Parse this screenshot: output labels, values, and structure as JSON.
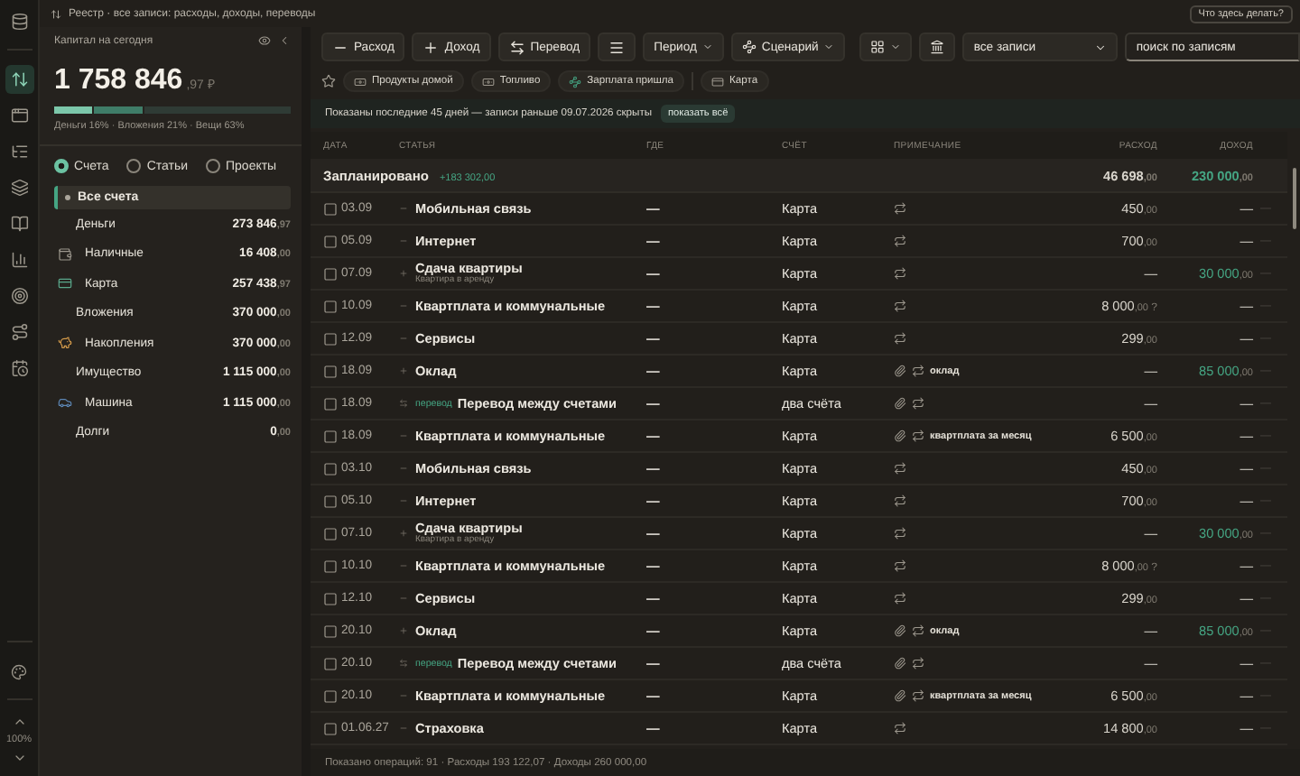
{
  "topbar": {
    "title": "Реестр",
    "subtitle": "· все записи: расходы, доходы, переводы",
    "help_button": "Что здесь делать?"
  },
  "rail": {
    "items": [
      {
        "kind": "registry",
        "selected": true
      },
      {
        "kind": "window",
        "selected": false
      },
      {
        "kind": "list",
        "selected": false
      },
      {
        "kind": "layers",
        "selected": false
      },
      {
        "kind": "book",
        "selected": false
      },
      {
        "kind": "chart",
        "selected": false
      },
      {
        "kind": "target",
        "selected": false
      },
      {
        "kind": "route",
        "selected": false
      },
      {
        "kind": "schedule",
        "selected": false
      }
    ],
    "zoom": "100%"
  },
  "capital": {
    "title": "Капитал на сегодня",
    "amount": "1 758 846",
    "cents": ",97 ₽",
    "segments": [
      {
        "level": 0.16,
        "color": "#7cc7aa"
      },
      {
        "level": 0.21,
        "color": "#3f7d68"
      },
      {
        "level": 0.63,
        "color": "#2f3b35"
      }
    ],
    "legend": "Деньги 16% · Вложения 21% · Вещи 63%"
  },
  "view_modes": [
    {
      "label": "Счета",
      "selected": true
    },
    {
      "label": "Статьи",
      "selected": false
    },
    {
      "label": "Проекты",
      "selected": false
    }
  ],
  "accounts": {
    "all": {
      "label": "Все счета",
      "selected": true
    },
    "groups": [
      {
        "label": "Деньги",
        "amount": "273 846",
        "cents": ",97",
        "children": [
          {
            "kind": "cash",
            "label": "Наличные",
            "amount": "16 408",
            "cents": ",00"
          },
          {
            "kind": "card",
            "label": "Карта",
            "amount": "257 438",
            "cents": ",97"
          }
        ]
      },
      {
        "label": "Вложения",
        "amount": "370 000",
        "cents": ",00",
        "children": [
          {
            "kind": "savings",
            "label": "Накопления",
            "amount": "370 000",
            "cents": ",00"
          }
        ]
      },
      {
        "label": "Имущество",
        "amount": "1 115 000",
        "cents": ",00",
        "children": [
          {
            "kind": "car",
            "label": "Машина",
            "amount": "1 115 000",
            "cents": ",00"
          }
        ]
      },
      {
        "label": "Долги",
        "amount": "0",
        "cents": ",00"
      }
    ]
  },
  "toolbar": {
    "actions": [
      {
        "kind": "expense",
        "label": "Расход"
      },
      {
        "kind": "income",
        "label": "Доход"
      },
      {
        "kind": "transfer",
        "label": "Перевод"
      }
    ],
    "period": "Период",
    "scenario": "Сценарий",
    "filter": "все записи",
    "search_placeholder": "поиск по записям"
  },
  "quick": [
    {
      "kind": "money",
      "label": "Продукты домой"
    },
    {
      "kind": "money",
      "label": "Топливо"
    },
    {
      "kind": "scenario",
      "label": "Зарплата пришла"
    },
    {
      "kind": "account",
      "label": "Карта"
    }
  ],
  "notice": {
    "text": "Показаны последние 45 дней — записи раньше 09.07.2026 скрыты",
    "button": "показать всё"
  },
  "columns": [
    "ДАТА",
    "СТАТЬЯ",
    "ГДЕ",
    "СЧЁТ",
    "ПРИМЕЧАНИЕ",
    "РАСХОД",
    "ДОХОД"
  ],
  "planned": {
    "label": "Запланировано",
    "delta": "+183 302,00",
    "expense": "46 698",
    "expense_cents": ",00",
    "income": "230 000",
    "income_cents": ",00"
  },
  "rows": [
    {
      "checked": false,
      "date": "03.09",
      "kind": "expense",
      "category": "Мобильная связь",
      "where": "—",
      "account": "Карта",
      "clip": false,
      "repeat": true,
      "expense": "450",
      "expense_cents": ",00",
      "income": "—",
      "extra": "—"
    },
    {
      "checked": false,
      "date": "05.09",
      "kind": "expense",
      "category": "Интернет",
      "where": "—",
      "account": "Карта",
      "clip": false,
      "repeat": true,
      "expense": "700",
      "expense_cents": ",00",
      "income": "—",
      "extra": "—"
    },
    {
      "checked": false,
      "date": "07.09",
      "kind": "income",
      "category": "Сдача квартиры",
      "subtitle": "Квартира в аренду",
      "where": "—",
      "account": "Карта",
      "clip": false,
      "repeat": true,
      "expense": "—",
      "income": "30 000",
      "income_cents": ",00",
      "extra": "—"
    },
    {
      "checked": false,
      "date": "10.09",
      "kind": "expense",
      "category": "Квартплата и коммунальные",
      "where": "—",
      "account": "Карта",
      "clip": false,
      "repeat": true,
      "expense": "8 000",
      "expense_cents": ",00",
      "flag": "?",
      "income": "—",
      "extra": "—"
    },
    {
      "checked": false,
      "date": "12.09",
      "kind": "expense",
      "category": "Сервисы",
      "where": "—",
      "account": "Карта",
      "clip": false,
      "repeat": true,
      "expense": "299",
      "expense_cents": ",00",
      "income": "—",
      "extra": "—"
    },
    {
      "checked": false,
      "date": "18.09",
      "kind": "income",
      "category": "Оклад",
      "where": "—",
      "account": "Карта",
      "clip": true,
      "repeat": true,
      "note": "оклад",
      "expense": "—",
      "income": "85 000",
      "income_cents": ",00",
      "extra": "—"
    },
    {
      "checked": false,
      "date": "18.09",
      "kind": "transfer",
      "badge": "перевод",
      "category": "Перевод между счетами",
      "where": "—",
      "account": "два счёта",
      "clip": true,
      "repeat": true,
      "expense": "—",
      "income": "—",
      "extra": "—"
    },
    {
      "checked": false,
      "date": "18.09",
      "kind": "expense",
      "category": "Квартплата и коммунальные",
      "where": "—",
      "account": "Карта",
      "clip": true,
      "repeat": true,
      "note": "квартплата за месяц",
      "expense": "6 500",
      "expense_cents": ",00",
      "income": "—",
      "extra": "—"
    },
    {
      "checked": false,
      "date": "03.10",
      "kind": "expense",
      "category": "Мобильная связь",
      "where": "—",
      "account": "Карта",
      "clip": false,
      "repeat": true,
      "expense": "450",
      "expense_cents": ",00",
      "income": "—",
      "extra": "—"
    },
    {
      "checked": false,
      "date": "05.10",
      "kind": "expense",
      "category": "Интернет",
      "where": "—",
      "account": "Карта",
      "clip": false,
      "repeat": true,
      "expense": "700",
      "expense_cents": ",00",
      "income": "—",
      "extra": "—"
    },
    {
      "checked": false,
      "date": "07.10",
      "kind": "income",
      "category": "Сдача квартиры",
      "subtitle": "Квартира в аренду",
      "where": "—",
      "account": "Карта",
      "clip": false,
      "repeat": true,
      "expense": "—",
      "income": "30 000",
      "income_cents": ",00",
      "extra": "—"
    },
    {
      "checked": false,
      "date": "10.10",
      "kind": "expense",
      "category": "Квартплата и коммунальные",
      "where": "—",
      "account": "Карта",
      "clip": false,
      "repeat": true,
      "expense": "8 000",
      "expense_cents": ",00",
      "flag": "?",
      "income": "—",
      "extra": "—"
    },
    {
      "checked": false,
      "date": "12.10",
      "kind": "expense",
      "category": "Сервисы",
      "where": "—",
      "account": "Карта",
      "clip": false,
      "repeat": true,
      "expense": "299",
      "expense_cents": ",00",
      "income": "—",
      "extra": "—"
    },
    {
      "checked": false,
      "date": "20.10",
      "kind": "income",
      "category": "Оклад",
      "where": "—",
      "account": "Карта",
      "clip": true,
      "repeat": true,
      "note": "оклад",
      "expense": "—",
      "income": "85 000",
      "income_cents": ",00",
      "extra": "—"
    },
    {
      "checked": false,
      "date": "20.10",
      "kind": "transfer",
      "badge": "перевод",
      "category": "Перевод между счетами",
      "where": "—",
      "account": "два счёта",
      "clip": true,
      "repeat": true,
      "expense": "—",
      "income": "—",
      "extra": "—"
    },
    {
      "checked": false,
      "date": "20.10",
      "kind": "expense",
      "category": "Квартплата и коммунальные",
      "where": "—",
      "account": "Карта",
      "clip": true,
      "repeat": true,
      "note": "квартплата за месяц",
      "expense": "6 500",
      "expense_cents": ",00",
      "income": "—",
      "extra": "—"
    },
    {
      "checked": false,
      "date": "01.06.27",
      "kind": "expense",
      "category": "Страховка",
      "where": "—",
      "account": "Карта",
      "clip": false,
      "repeat": true,
      "expense": "14 800",
      "expense_cents": ",00",
      "income": "—",
      "extra": "—"
    }
  ],
  "footer": "Показано операций: 91 · Расходы 193 122,07 · Доходы 260 000,00"
}
